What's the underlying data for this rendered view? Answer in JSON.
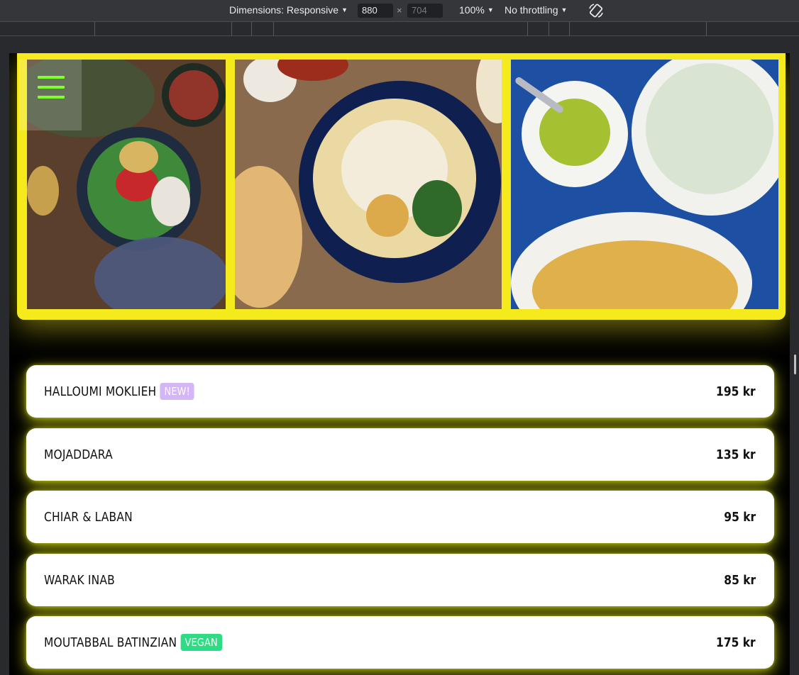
{
  "devtools": {
    "dimensions_label": "Dimensions: Responsive",
    "width_value": "880",
    "times": "×",
    "height_placeholder": "704",
    "zoom_label": "100%",
    "throttle_label": "No throttling",
    "rotate_icon": "rotate-icon"
  },
  "menu": {
    "hamburger_icon": "hamburger-icon",
    "accent_color": "#7dff2a"
  },
  "hero": {
    "border_color": "#f5ea1c",
    "photos": [
      "salad-bowl-photo",
      "hummus-plate-photo",
      "mezze-bowls-photo"
    ]
  },
  "items": [
    {
      "name": "HALLOUMI MOKLIEH",
      "badge": "NEW!",
      "price": "195 kr"
    },
    {
      "name": "MOJADDARA",
      "badge": "",
      "price": "135 kr"
    },
    {
      "name": "CHIAR & LABAN",
      "badge": "",
      "price": "95 kr"
    },
    {
      "name": "WARAK INAB",
      "badge": "",
      "price": "85 kr"
    },
    {
      "name": "MOUTABBAL BATINZIAN",
      "badge": "VEGAN",
      "price": "175 kr"
    }
  ]
}
